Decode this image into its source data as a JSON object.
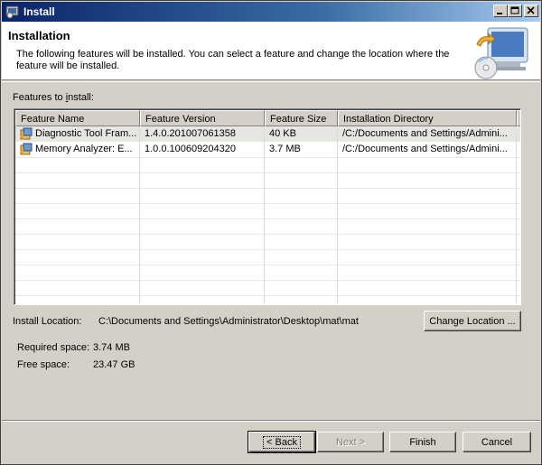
{
  "window": {
    "title": "Install",
    "icon": "eclipse-install-icon",
    "controls": [
      "minimize",
      "maximize",
      "close"
    ]
  },
  "header": {
    "title": "Installation",
    "description": "The following features will be installed. You can select a feature and change the location where the feature will be installed.",
    "graphic": "install-wizard-graphic"
  },
  "features": {
    "label": "Features to install:",
    "columns": [
      "Feature Name",
      "Feature Version",
      "Feature Size",
      "Installation Directory"
    ],
    "rows": [
      {
        "name": "Diagnostic Tool Fram...",
        "version": "1.4.0.201007061358",
        "size": "40 KB",
        "directory": "/C:/Documents and Settings/Admini...",
        "selected": true
      },
      {
        "name": "Memory Analyzer: E...",
        "version": "1.0.0.100609204320",
        "size": "3.7 MB",
        "directory": "/C:/Documents and Settings/Admini...",
        "selected": false
      }
    ]
  },
  "location": {
    "label": "Install Location:",
    "value": "C:\\Documents and Settings\\Administrator\\Desktop\\mat\\mat",
    "change_button": "Change Location ..."
  },
  "space": {
    "required_label": "Required space:",
    "required_value": "3.74 MB",
    "free_label": "Free space:",
    "free_value": "23.47 GB"
  },
  "buttons": {
    "back": "< Back",
    "next": "Next >",
    "finish": "Finish",
    "cancel": "Cancel"
  }
}
